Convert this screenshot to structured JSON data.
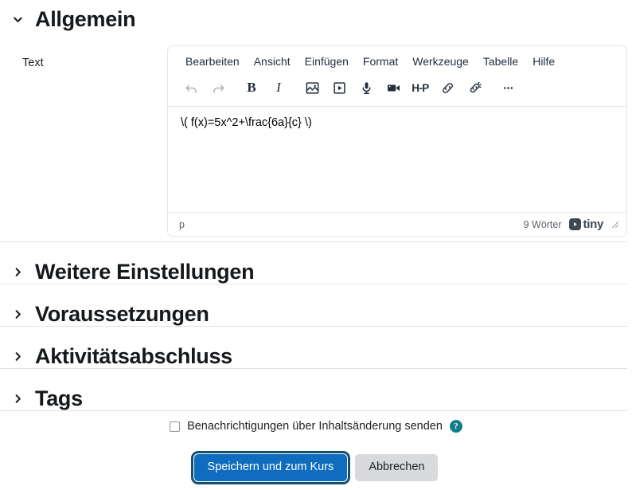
{
  "sections": [
    {
      "id": "allgemein",
      "title": "Allgemein",
      "expanded": true,
      "chevron": "chevron-down-icon"
    },
    {
      "id": "weitere-einstellungen",
      "title": "Weitere Einstellungen",
      "expanded": false,
      "chevron": "chevron-right-icon"
    },
    {
      "id": "voraussetzungen",
      "title": "Voraussetzungen",
      "expanded": false,
      "chevron": "chevron-right-icon"
    },
    {
      "id": "aktivitaetsabschluss",
      "title": "Aktivitätsabschluss",
      "expanded": false,
      "chevron": "chevron-right-icon"
    },
    {
      "id": "tags",
      "title": "Tags",
      "expanded": false,
      "chevron": "chevron-right-icon"
    }
  ],
  "form": {
    "text_label": "Text"
  },
  "editor": {
    "menubar": [
      {
        "label": "Bearbeiten",
        "name": "menu-edit"
      },
      {
        "label": "Ansicht",
        "name": "menu-view"
      },
      {
        "label": "Einfügen",
        "name": "menu-insert"
      },
      {
        "label": "Format",
        "name": "menu-format"
      },
      {
        "label": "Werkzeuge",
        "name": "menu-tools"
      },
      {
        "label": "Tabelle",
        "name": "menu-table"
      },
      {
        "label": "Hilfe",
        "name": "menu-help"
      }
    ],
    "toolbar": [
      {
        "icon": "undo-icon",
        "label": "Rückgängig",
        "disabled": true
      },
      {
        "icon": "redo-icon",
        "label": "Wiederholen",
        "disabled": true
      },
      {
        "icon": "bold-icon",
        "label": "Fett",
        "glyph": "B"
      },
      {
        "icon": "italic-icon",
        "label": "Kursiv",
        "glyph": "I"
      },
      {
        "icon": "image-icon",
        "label": "Bild einfügen"
      },
      {
        "icon": "media-icon",
        "label": "Medien einfügen"
      },
      {
        "icon": "microphone-icon",
        "label": "Audioaufnahme"
      },
      {
        "icon": "video-camera-icon",
        "label": "Videoaufnahme"
      },
      {
        "icon": "h5p-icon",
        "label": "H5P",
        "glyph": "H-P"
      },
      {
        "icon": "link-icon",
        "label": "Link einfügen"
      },
      {
        "icon": "unlink-icon",
        "label": "Link entfernen"
      },
      {
        "icon": "more-icon",
        "label": "Mehr",
        "glyph": "•••"
      }
    ],
    "content": "\\( f(x)=5x^2+\\frac{6a}{c} \\)",
    "status": {
      "element_path": "p",
      "word_count": "9 Wörter",
      "brand": "tiny",
      "resize_handle": "resize-grip-icon"
    }
  },
  "notify": {
    "checked": false,
    "label": "Benachrichtigungen über Inhaltsänderung senden",
    "help": "?"
  },
  "actions": {
    "primary_label": "Speichern und zum Kurs",
    "secondary_label": "Abbrechen"
  },
  "colors": {
    "primary": "#0f6cbf",
    "focus_ring": "#17506b",
    "secondary_bg": "#d8dade",
    "help_teal": "#127e8a",
    "divider": "#dee2e6",
    "editor_border": "#e3e5e8",
    "tiny_mark": "#3d4853"
  }
}
